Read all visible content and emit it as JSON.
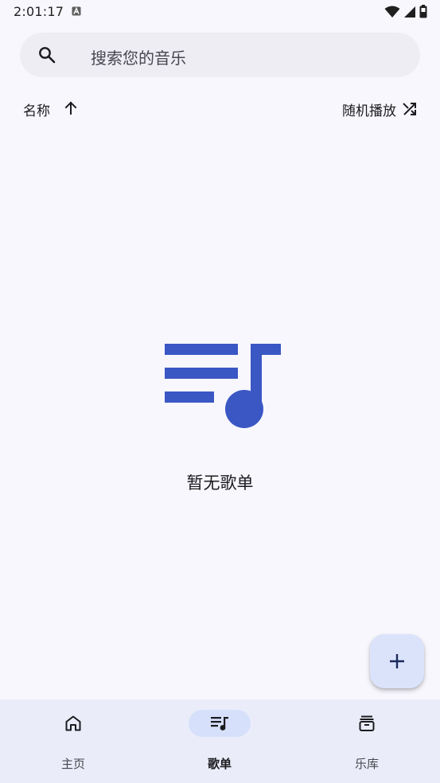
{
  "status_bar": {
    "time": "2:01:17",
    "icons": [
      "notification-a-icon",
      "wifi-icon",
      "signal-icon",
      "battery-icon"
    ]
  },
  "search": {
    "placeholder": "搜索您的音乐",
    "icon": "search-icon"
  },
  "sort_bar": {
    "sort_label": "名称",
    "sort_icon": "arrow-up-icon",
    "shuffle_label": "随机播放",
    "shuffle_icon": "shuffle-icon"
  },
  "empty_state": {
    "icon": "playlist-music-icon",
    "message": "暂无歌单"
  },
  "fab": {
    "icon": "plus-icon"
  },
  "bottom_nav": {
    "items": [
      {
        "label": "主页",
        "icon": "home-icon",
        "active": false
      },
      {
        "label": "歌单",
        "icon": "playlist-icon",
        "active": true
      },
      {
        "label": "乐库",
        "icon": "library-icon",
        "active": false
      }
    ]
  },
  "colors": {
    "background": "#f8f7fd",
    "accent": "#3a57c4",
    "search_bg": "#ededf3",
    "nav_bg": "#eaedf9",
    "nav_active_pill": "#d7e0fb",
    "fab_bg": "#dbe3fb"
  }
}
